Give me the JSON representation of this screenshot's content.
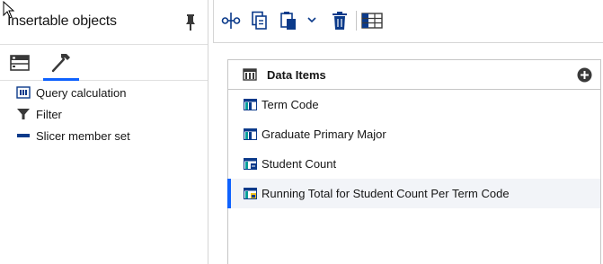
{
  "left_panel": {
    "title": "Insertable objects",
    "tabs": [
      {
        "name": "toolbox",
        "icon": "toolbox-icon"
      },
      {
        "name": "data",
        "icon": "hammer-icon",
        "active": true
      }
    ],
    "objects": [
      {
        "label": "Query calculation",
        "icon": "query-calculation-icon"
      },
      {
        "label": "Filter",
        "icon": "filter-icon"
      },
      {
        "label": "Slicer member set",
        "icon": "slicer-member-set-icon"
      }
    ]
  },
  "toolbar": {
    "buttons": [
      {
        "icon": "cut-icon"
      },
      {
        "icon": "copy-icon"
      },
      {
        "icon": "paste-icon"
      },
      {
        "icon": "chevron-down-icon"
      },
      {
        "icon": "delete-icon"
      },
      {
        "icon": "table-properties-icon"
      }
    ]
  },
  "data_items": {
    "title": "Data Items",
    "add_icon": "add-icon",
    "rows": [
      {
        "label": "Term Code",
        "icon": "data-item-icon",
        "selected": false
      },
      {
        "label": "Graduate Primary Major",
        "icon": "data-item-icon",
        "selected": false
      },
      {
        "label": "Student Count",
        "icon": "data-item-measure-icon",
        "selected": false
      },
      {
        "label": "Running Total for Student Count Per Term Code",
        "icon": "data-item-calculated-icon",
        "selected": true
      }
    ]
  },
  "colors": {
    "accent": "#0f62fe",
    "icon_blue": "#0b3a8a",
    "teal": "#009d9a",
    "selected_bg": "#f2f4f8"
  }
}
